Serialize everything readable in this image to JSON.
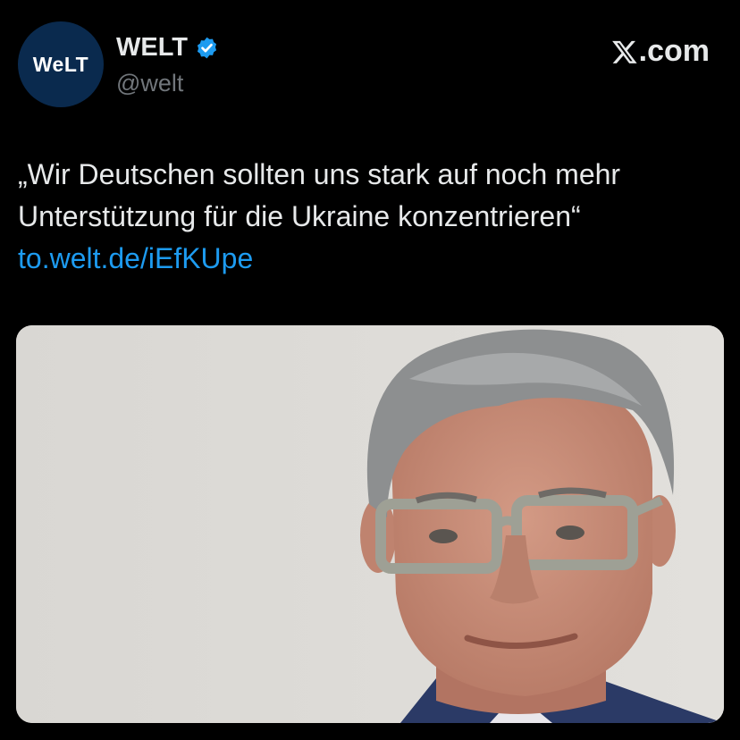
{
  "account": {
    "avatar_text": "WeLT",
    "display_name": "WELT",
    "handle": "@welt",
    "verified": true
  },
  "brand": {
    "label": ".com",
    "icon": "x-logo-icon"
  },
  "tweet": {
    "line1": "„Wir Deutschen sollten uns stark auf noch mehr",
    "line2": "Unterstützung für die Ukraine konzentrieren“",
    "link": "to.welt.de/iEfKUpe"
  },
  "media": {
    "alt_icon": "portrait-photo",
    "colors": {
      "background": "#dcdad6",
      "hair": "#8d8f90",
      "skin": "#c98f7a",
      "glasses": "#9ea095",
      "jacket": "#2b3a66"
    }
  },
  "colors": {
    "background": "#000000",
    "text": "#e7e9ea",
    "muted": "#71767b",
    "link": "#1d9bf0",
    "verified": "#1d9bf0",
    "avatar_bg": "#0a2a4e"
  }
}
